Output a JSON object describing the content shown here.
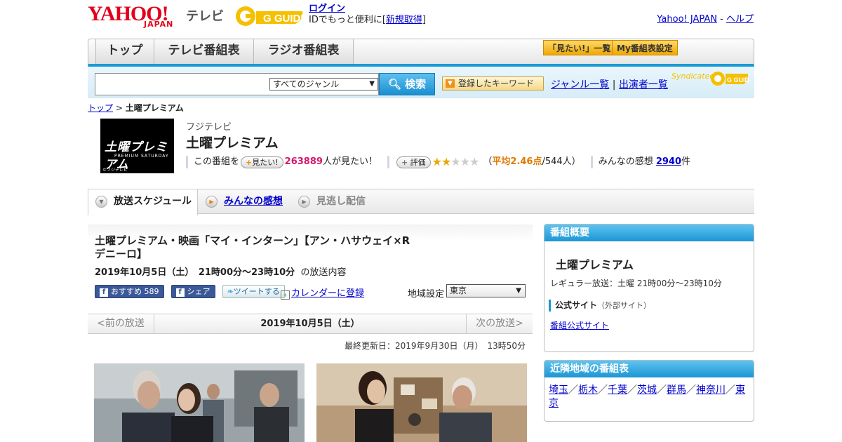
{
  "header": {
    "logo_yahoo": "YAHOO!",
    "logo_japan": "JAPAN",
    "logo_tv": "テレビ",
    "gguide_logo": "G GUIDE",
    "login_label": "ログイン",
    "login_prompt": "IDでもっと便利に[",
    "register_label": "新規取得",
    "login_suffix": "]",
    "yahoo_japan_link": "Yahoo! JAPAN",
    "separator": "-",
    "help_link": "ヘルプ"
  },
  "nav": {
    "tabs": [
      "トップ",
      "テレビ番組表",
      "ラジオ番組表"
    ],
    "mitai_list": "「見たい!」一覧",
    "my_schedule": "My番組表設定"
  },
  "search": {
    "genre_select": "すべてのジャンル",
    "search_button": "検索",
    "keyword_button": "登録したキーワード",
    "genre_list": "ジャンル一覧",
    "divider": "|",
    "cast_list": "出演者一覧",
    "syndicated": "Syndicated",
    "syn_logo": "G GUIDE"
  },
  "breadcrumb": {
    "top": "トップ",
    "sep": ">",
    "current": "土曜プレミアム"
  },
  "program": {
    "thumb_title": "土曜プレミアム",
    "thumb_sub": "PREMIUM SATURDAY",
    "thumb_copy": "©フジテレビ",
    "channel": "フジテレビ",
    "title": "土曜プレミアム",
    "this_program": "この番組を",
    "mitai_btn": "見たい!",
    "mitai_count": "263889",
    "mitai_suffix": "人が見たい！",
    "rate_btn": "評価",
    "rating": 2,
    "rating_max": 5,
    "rating_open": "（",
    "avg_label": "平均2.46点",
    "avg_votes": "/544人）",
    "impressions_label": "みんなの感想",
    "impressions_count": "2940",
    "impressions_suffix": "件"
  },
  "tabs": {
    "schedule": "放送スケジュール",
    "impressions": "みんなの感想",
    "missed": "見逃し配信"
  },
  "episode": {
    "title": "土曜プレミアム・映画「マイ・インターン」【アン・ハサウェイ×Rデニーロ】",
    "date_time": "2019年10月5日（土）　21時00分～23時10分",
    "date_suffix": "の放送内容",
    "fb_recommend": "おすすめ",
    "fb_count": "589",
    "fb_share": "シェア",
    "tweet": "ツイートする",
    "calendar": "カレンダーに登録",
    "region_label": "地域設定",
    "region_value": "東京",
    "prev": "<前の放送",
    "current_date": "2019年10月5日（土）",
    "next": "次の放送>",
    "updated": "最終更新日：2019年9月30日（月）　13時50分"
  },
  "sidebar": {
    "overview_header": "番組概要",
    "overview_title": "土曜プレミアム",
    "regular": "レギュラー放送：土曜 21時00分～23時10分",
    "official_label": "公式サイト",
    "official_note": "（外部サイト）",
    "official_link": "番組公式サイト",
    "nearby_header": "近隣地域の番組表",
    "nearby": [
      "埼玉",
      "栃木",
      "千葉",
      "茨城",
      "群馬",
      "神奈川",
      "東京"
    ],
    "nearby_sep": "／"
  },
  "colors": {
    "accent_blue": "#1b96d4",
    "yahoo_red": "#e2001a",
    "pink_count": "#d8176b",
    "star_gold": "#e8a800"
  }
}
